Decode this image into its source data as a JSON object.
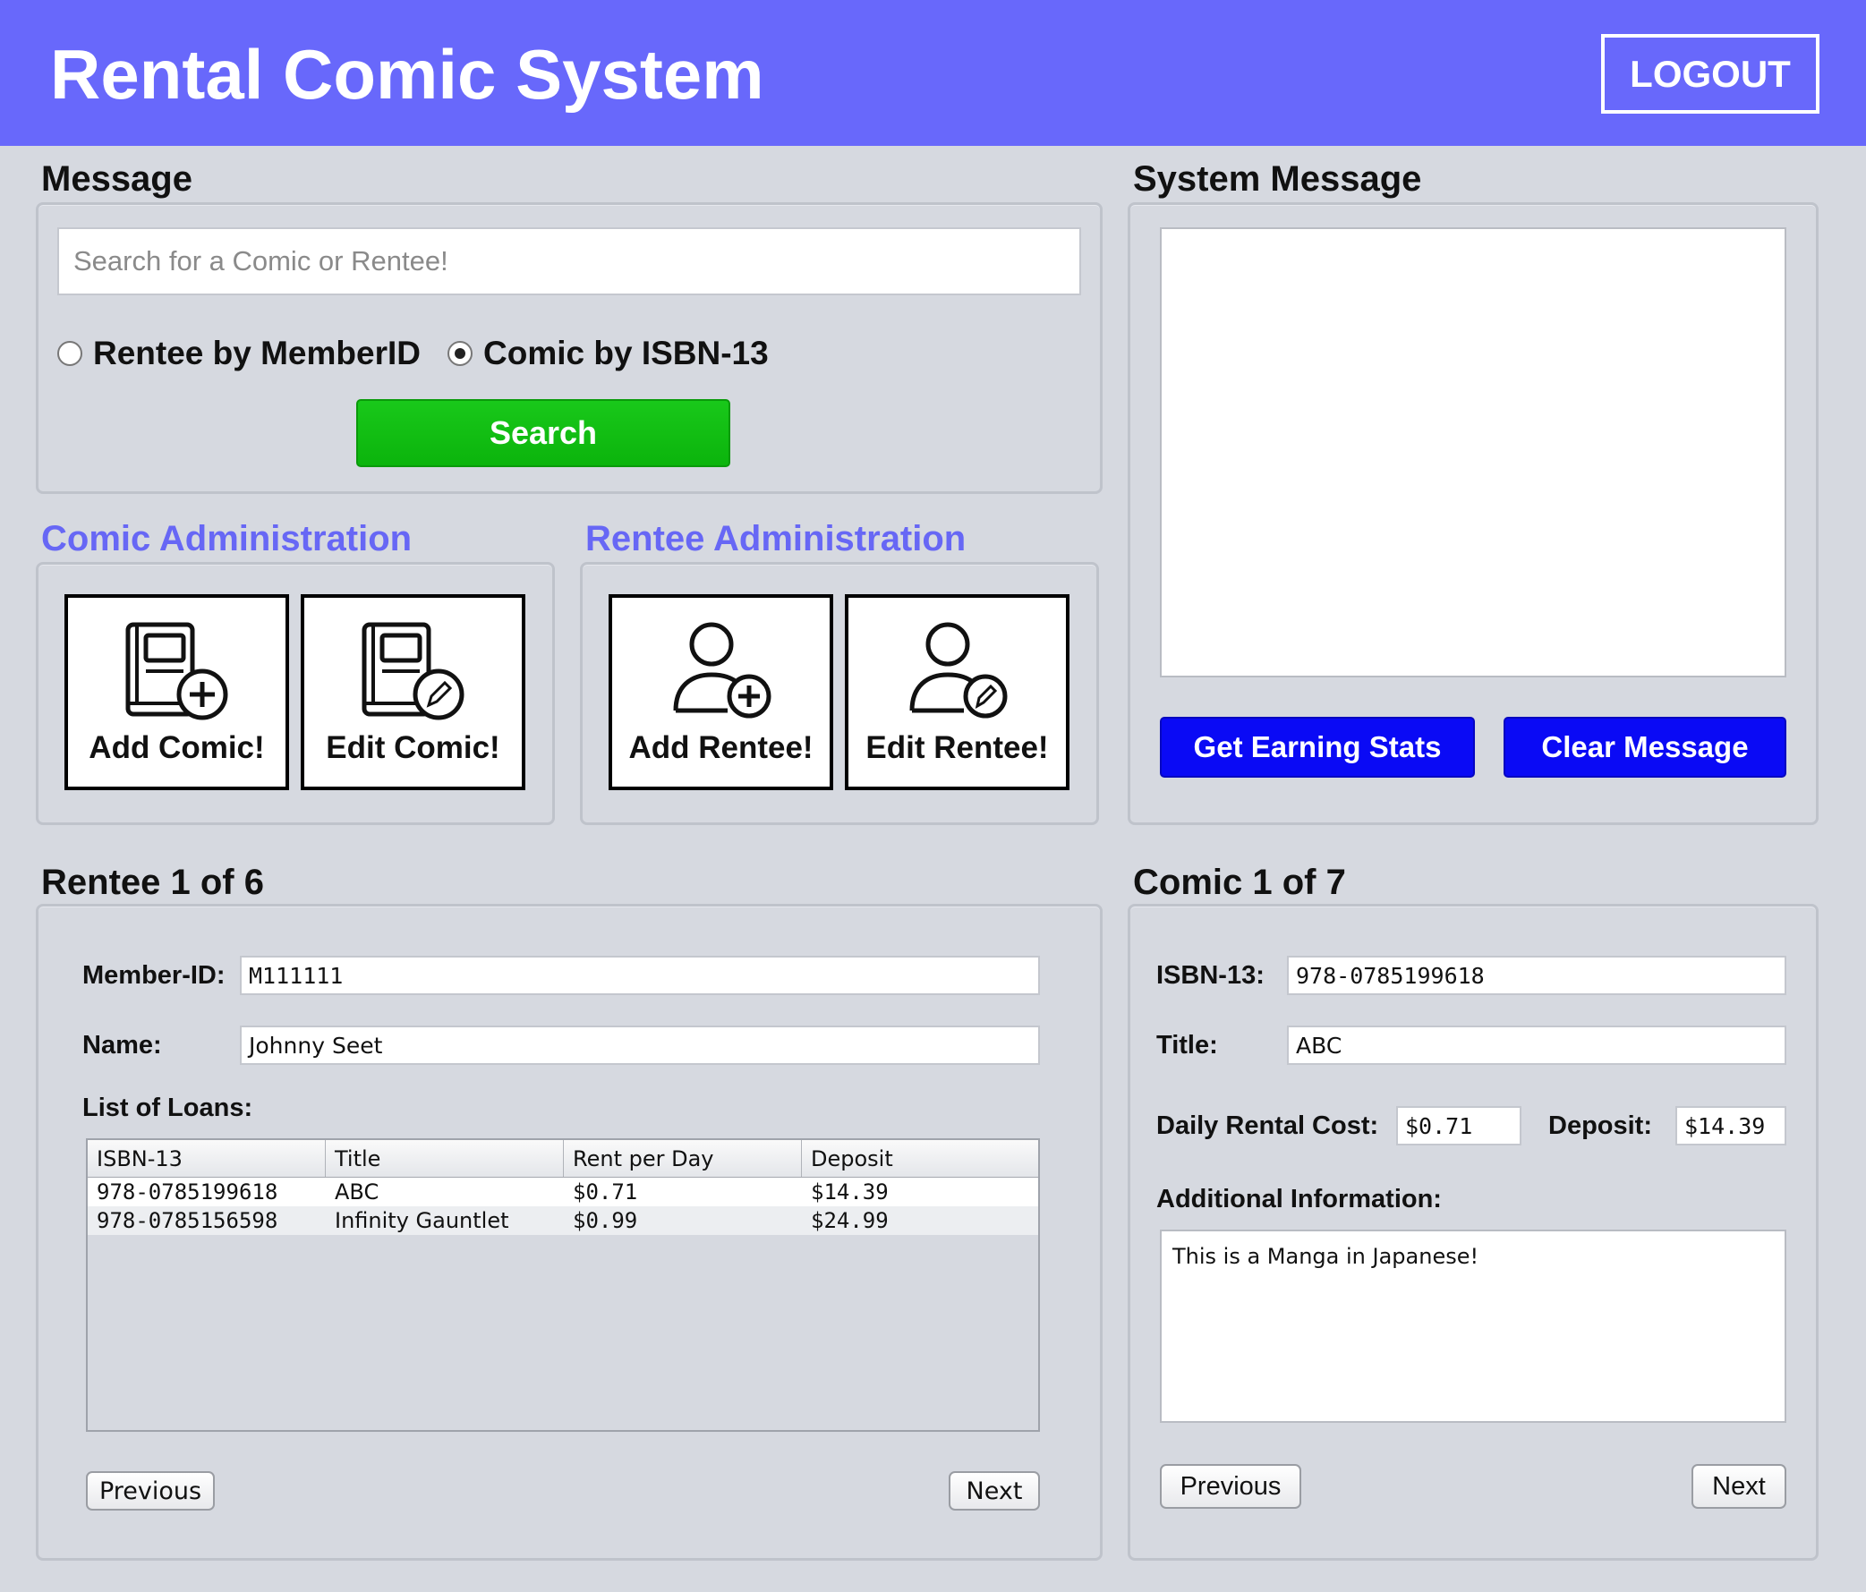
{
  "header": {
    "title": "Rental Comic System",
    "logout_label": "LOGOUT"
  },
  "message": {
    "title": "Message",
    "search_placeholder": "Search for a Comic or Rentee!",
    "search_value": "",
    "radio_rentee": "Rentee by MemberID",
    "radio_comic": "Comic by ISBN-13",
    "selected": "comic",
    "search_label": "Search"
  },
  "comic_admin": {
    "title": "Comic Administration",
    "add_label": "Add Comic!",
    "edit_label": "Edit Comic!"
  },
  "rentee_admin": {
    "title": "Rentee Administration",
    "add_label": "Add Rentee!",
    "edit_label": "Edit Rentee!"
  },
  "system_message": {
    "title": "System Message",
    "text": "",
    "earning_label": "Get Earning Stats",
    "clear_label": "Clear Message"
  },
  "rentee": {
    "title": "Rentee 1 of 6",
    "member_id_label": "Member-ID:",
    "member_id": "M111111",
    "name_label": "Name:",
    "name": "Johnny Seet",
    "loans_label": "List of Loans:",
    "columns": [
      "ISBN-13",
      "Title",
      "Rent per Day",
      "Deposit"
    ],
    "loans": [
      {
        "isbn": "978-0785199618",
        "title": "ABC",
        "rent": "$0.71",
        "deposit": "$14.39"
      },
      {
        "isbn": "978-0785156598",
        "title": "Infinity Gauntlet",
        "rent": "$0.99",
        "deposit": "$24.99"
      }
    ],
    "prev_label": "Previous",
    "next_label": "Next"
  },
  "comic": {
    "title": "Comic 1 of 7",
    "isbn_label": "ISBN-13:",
    "isbn": "978-0785199618",
    "title_label": "Title:",
    "comic_title": "ABC",
    "cost_label": "Daily Rental Cost:",
    "cost": "$0.71",
    "deposit_label": "Deposit:",
    "deposit": "$14.39",
    "info_label": "Additional Information:",
    "info": "This is a Manga in Japanese!",
    "prev_label": "Previous",
    "next_label": "Next"
  },
  "colors": {
    "header_bg": "#6868fb",
    "search_button": "#0bb40c",
    "action_button": "#0a0af5",
    "admin_title": "#6767f5"
  }
}
